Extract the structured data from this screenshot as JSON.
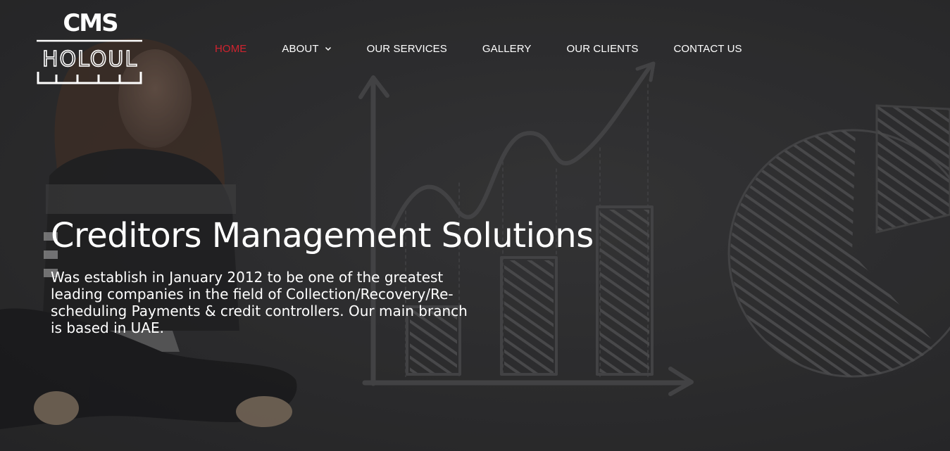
{
  "brand": {
    "logo_top": "CMS",
    "logo_middle": "HOLOUL",
    "logo_bottom_arabic": "حلول"
  },
  "nav": {
    "items": [
      {
        "label": "HOME",
        "active": true
      },
      {
        "label": "ABOUT",
        "has_dropdown": true
      },
      {
        "label": "OUR SERVICES"
      },
      {
        "label": "GALLERY"
      },
      {
        "label": "OUR CLIENTS"
      },
      {
        "label": "CONTACT US"
      }
    ]
  },
  "hero": {
    "title": "Creditors Management Solutions",
    "description": "Was establish in January 2012 to be one of the greatest leading companies in the field of Collection/Recovery/Re-scheduling Payments & credit controllers. Our main branch is based in UAE."
  },
  "colors": {
    "active_nav": "#d0232f",
    "text": "#ffffff",
    "background": "#2f2f31"
  }
}
